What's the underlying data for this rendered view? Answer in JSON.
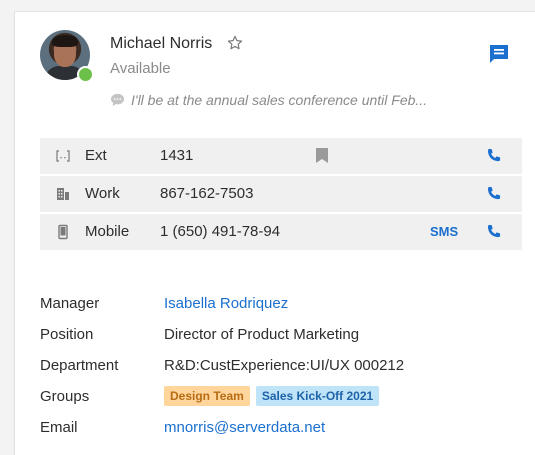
{
  "contact": {
    "name": "Michael Norris",
    "availability": "Available",
    "status_message": "I'll be at the annual sales conference until Feb..."
  },
  "phones": [
    {
      "label": "Ext",
      "number": "1431",
      "icon": "extension-icon",
      "sms": ""
    },
    {
      "label": "Work",
      "number": "867-162-7503",
      "icon": "office-building-icon",
      "sms": ""
    },
    {
      "label": "Mobile",
      "number": "1 (650) 491-78-94",
      "icon": "mobile-phone-icon",
      "sms": "SMS"
    }
  ],
  "details": {
    "manager_label": "Manager",
    "manager_value": "Isabella Rodriquez",
    "position_label": "Position",
    "position_value": "Director of Product Marketing",
    "department_label": "Department",
    "department_value": "R&D:CustExperience:UI/UX 000212",
    "groups_label": "Groups",
    "groups": [
      "Design Team",
      "Sales Kick-Off 2021"
    ],
    "email_label": "Email",
    "email_value": "mnorris@serverdata.net"
  },
  "colors": {
    "accent": "#1a6fcf",
    "status_online": "#6cc04a",
    "tag_orange_bg": "#ffd59b",
    "tag_blue_bg": "#bfe4f8"
  }
}
